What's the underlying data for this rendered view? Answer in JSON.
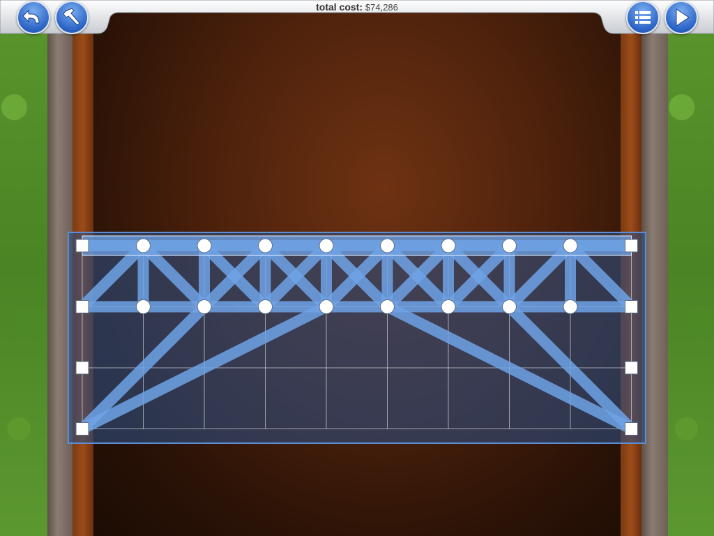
{
  "header": {
    "cost_label": "total cost:",
    "cost_value": "$74,286"
  },
  "toolbar": {
    "left_buttons": [
      {
        "name": "back-button",
        "icon": "back-arrow-icon"
      },
      {
        "name": "build-button",
        "icon": "hammer-icon"
      }
    ],
    "right_buttons": [
      {
        "name": "menu-button",
        "icon": "list-icon"
      },
      {
        "name": "play-button",
        "icon": "play-icon"
      }
    ]
  },
  "colors": {
    "beam": "#6fa3e6",
    "grid_panel": "#2e4f80",
    "button_blue": "#2b63c6",
    "grass": "#5a962c",
    "canyon": "#4e220c"
  },
  "bridge": {
    "grid_columns": 9,
    "grid_rows": 3,
    "anchor_count": 8,
    "joint_count": 16,
    "member_count": 46
  }
}
